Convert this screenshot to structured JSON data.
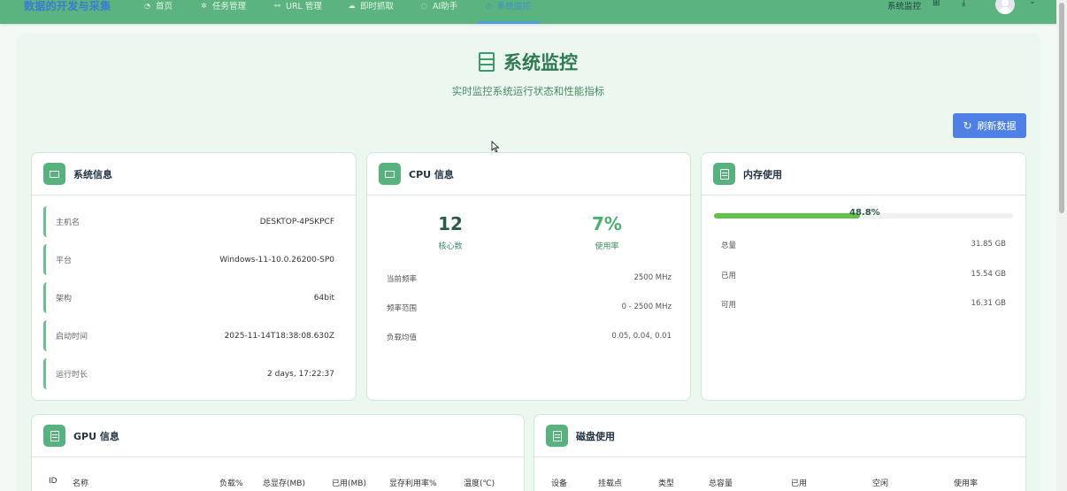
{
  "nav": {
    "brand": "数据的开发与采集",
    "items": [
      {
        "label": "首页",
        "icon": "dashboard-icon"
      },
      {
        "label": "任务管理",
        "icon": "bug-icon"
      },
      {
        "label": "URL 管理",
        "icon": "link-icon"
      },
      {
        "label": "即时抓取",
        "icon": "cloud-icon"
      },
      {
        "label": "AI助手",
        "icon": "chat-icon"
      },
      {
        "label": "系统监控",
        "icon": "clock-icon"
      }
    ],
    "right_title": "系统监控"
  },
  "page": {
    "title": "系统监控",
    "subtitle": "实时监控系统运行状态和性能指标",
    "refresh_label": "刷新数据"
  },
  "system_info": {
    "title": "系统信息",
    "rows": [
      {
        "label": "主机名",
        "value": "DESKTOP-4PSKPCF"
      },
      {
        "label": "平台",
        "value": "Windows-11-10.0.26200-SP0"
      },
      {
        "label": "架构",
        "value": "64bit"
      },
      {
        "label": "启动时间",
        "value": "2025-11-14T18:38:08.630Z"
      },
      {
        "label": "运行时长",
        "value": "2 days, 17:22:37"
      }
    ]
  },
  "cpu": {
    "title": "CPU 信息",
    "cores": "12",
    "cores_label": "核心数",
    "usage": "7%",
    "usage_label": "使用率",
    "rows": [
      {
        "label": "当前频率",
        "value": "2500 MHz"
      },
      {
        "label": "频率范围",
        "value": "0 - 2500 MHz"
      },
      {
        "label": "负载均值",
        "value": "0.05, 0.04, 0.01"
      }
    ]
  },
  "memory": {
    "title": "内存使用",
    "percent_text": "48.8%",
    "percent": 48.8,
    "rows": [
      {
        "label": "总量",
        "value": "31.85 GB"
      },
      {
        "label": "已用",
        "value": "15.54 GB"
      },
      {
        "label": "可用",
        "value": "16.31 GB"
      }
    ]
  },
  "gpu": {
    "title": "GPU 信息",
    "columns": [
      "ID",
      "名称",
      "负载%",
      "总显存(MB)",
      "已用(MB)",
      "显存利用率%",
      "温度(℃)"
    ]
  },
  "disk": {
    "title": "磁盘使用",
    "columns": [
      "设备",
      "挂载点",
      "类型",
      "总容量",
      "已用",
      "空闲",
      "使用率"
    ]
  },
  "colors": {
    "nav_bg": "#5bb37f",
    "accent_green": "#57b27e",
    "button_blue": "#4e80e6",
    "memory_bar": "#62c24a"
  }
}
